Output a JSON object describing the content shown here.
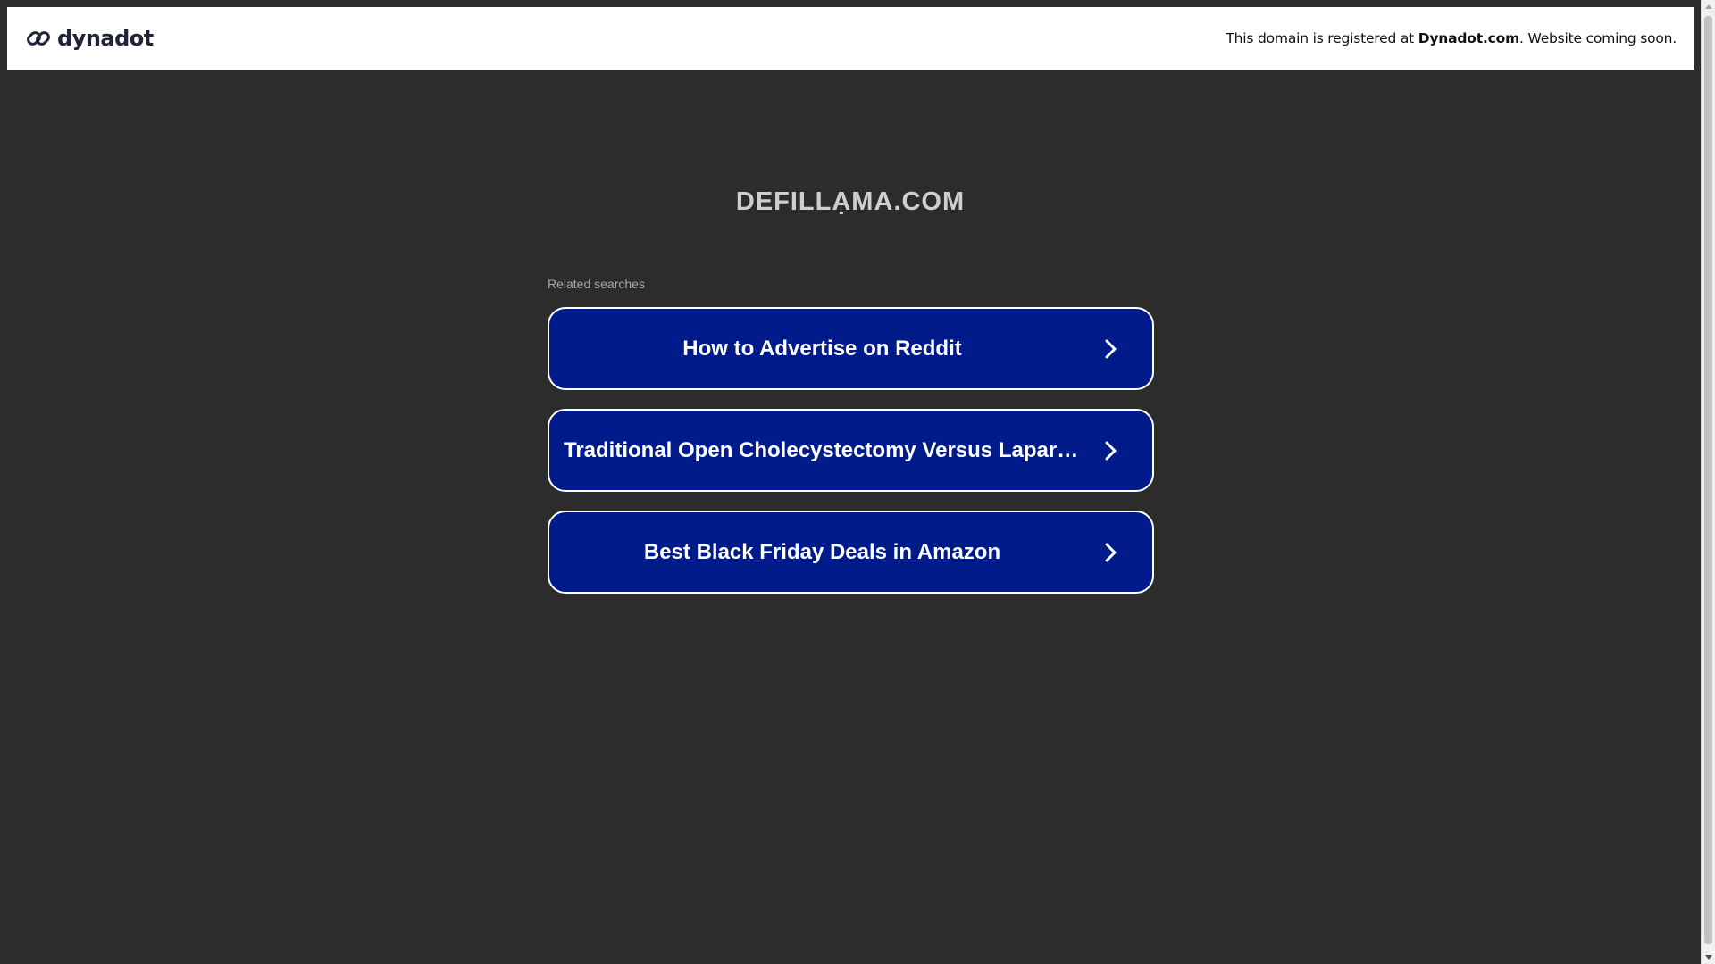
{
  "header": {
    "logo_text": "dynadot",
    "logo_icon": "chain-link-icon",
    "notice_prefix": "This domain is registered at ",
    "notice_brand": "Dynadot.com",
    "notice_suffix": ". Website coming soon."
  },
  "domain": "DEFILLẠMA.COM",
  "related_label": "Related searches",
  "results": [
    {
      "label": "How to Advertise on Reddit",
      "icon": "chevron-right-icon"
    },
    {
      "label": "Traditional Open Cholecystectomy Versus Laparoscopic Cholecystectomy",
      "icon": "chevron-right-icon"
    },
    {
      "label": "Best Black Friday Deals in Amazon",
      "icon": "chevron-right-icon"
    }
  ],
  "colors": {
    "background": "#2c2c2c",
    "button": "#011c8a",
    "button_border": "#ffffff",
    "topbar": "#ffffff",
    "logo": "#1f2436"
  }
}
